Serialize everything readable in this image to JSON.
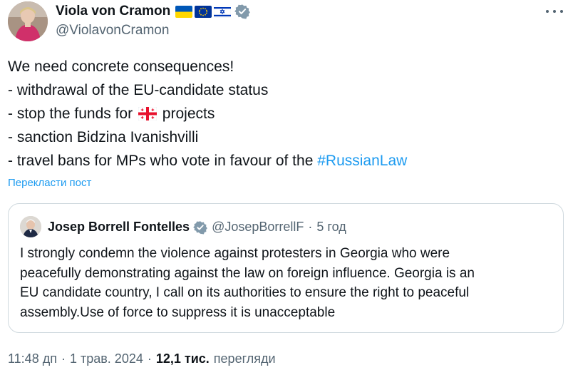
{
  "author": {
    "display_name": "Viola von Cramon",
    "handle": "@ViolavonCramon",
    "flags": [
      "ukraine-flag",
      "eu-flag",
      "israel-flag"
    ],
    "verified": true
  },
  "tweet": {
    "line1": "We need concrete consequences!",
    "line2": "- withdrawal of the EU-candidate status",
    "line3_before": "- stop the funds for",
    "line3_flag": "georgia-flag",
    "line3_after": "projects",
    "line4": "- sanction Bidzina Ivanishvilli",
    "line5_before": "- travel bans for MPs who vote in favour of the",
    "line5_hashtag": "#RussianLaw"
  },
  "translate_label": "Перекласти пост",
  "quote": {
    "display_name": "Josep Borrell Fontelles",
    "handle": "@JosepBorrellF",
    "separator": "·",
    "time": "5 год",
    "lines": [
      "I strongly condemn the violence against protesters in Georgia who were",
      "peacefully demonstrating against the law on foreign influence. Georgia is an",
      "EU candidate country, I call on its authorities to ensure the right to peaceful",
      "assembly.Use of force to suppress it is unacceptable"
    ]
  },
  "meta": {
    "time": "11:48 дп",
    "separator": "·",
    "date": "1 трав. 2024",
    "views_count": "12,1 тис.",
    "views_label": "перегляди"
  },
  "colors": {
    "text": "#0f1419",
    "secondary": "#536471",
    "link": "#1d9bf0",
    "border": "#cfd9de",
    "verified": "#829aab"
  }
}
